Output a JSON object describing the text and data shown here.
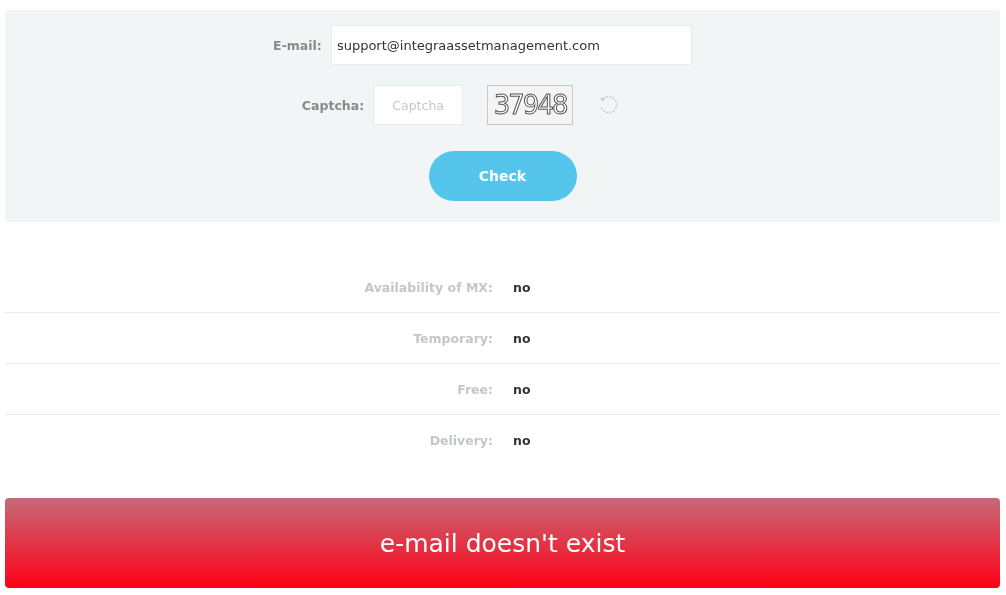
{
  "form": {
    "email_label": "E-mail:",
    "email_value": "support@integraassetmanagement.com",
    "captcha_label": "Captcha:",
    "captcha_placeholder": "Captcha",
    "captcha_image_text": "37948",
    "button": "Check"
  },
  "results": [
    {
      "label": "Availability of MX:",
      "value": "no"
    },
    {
      "label": "Temporary:",
      "value": "no"
    },
    {
      "label": "Free:",
      "value": "no"
    },
    {
      "label": "Delivery:",
      "value": "no"
    }
  ],
  "verdict": {
    "text": "e-mail doesn't exist",
    "exists": false
  }
}
